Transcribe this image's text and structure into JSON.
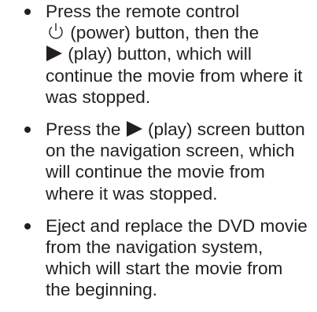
{
  "bullets": [
    {
      "line1": "Press the remote control",
      "line2_suffix": " (power) button, then the",
      "line3_suffix": " (play) button, which will",
      "line4": "continue the movie from where it",
      "line5": "was stopped."
    },
    {
      "line1_prefix": "Press the ",
      "line1_suffix": " (play) screen button",
      "line2": "on the navigation screen, which",
      "line3": "will continue the movie from",
      "line4": "where it was stopped."
    },
    {
      "line1": "Eject and replace the DVD movie",
      "line2": "from the navigation system,",
      "line3": "which will start the movie from",
      "line4": "the beginning."
    }
  ],
  "icons": {
    "power": "power-icon",
    "play": "play-icon"
  }
}
